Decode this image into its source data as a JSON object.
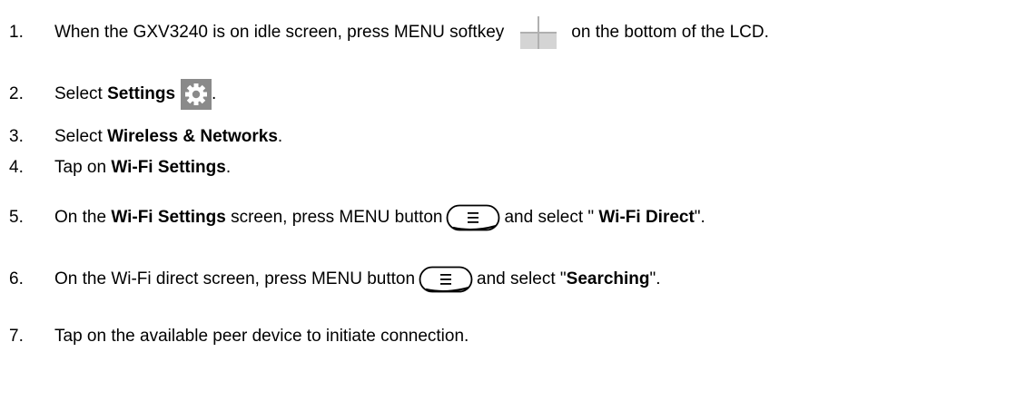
{
  "steps": [
    {
      "num": "1.",
      "a": "When the GXV3240 is on idle screen, press MENU softkey",
      "icon": "menu-softkey-icon",
      "b": "on the bottom of the LCD."
    },
    {
      "num": "2.",
      "a": "Select ",
      "bold": "Settings",
      "icon": "settings-gear-icon",
      "b": "."
    },
    {
      "num": "3.",
      "a": "Select ",
      "bold": "Wireless & Networks",
      "b": "."
    },
    {
      "num": "4.",
      "a": "Tap on ",
      "bold": "Wi-Fi Settings",
      "b": "."
    },
    {
      "num": "5.",
      "a": "On the ",
      "bold": "Wi-Fi Settings",
      "a2": " screen, press MENU button",
      "icon": "menu-button-icon",
      "b": "and select \" ",
      "bold2": "Wi-Fi Direct",
      "c": "\"."
    },
    {
      "num": "6.",
      "a": "On the Wi-Fi direct screen, press MENU button",
      "icon": "menu-button-icon",
      "b": "and select \"",
      "bold": "Searching",
      "c": "\"."
    },
    {
      "num": "7.",
      "a": "Tap on the available peer device to initiate connection."
    }
  ]
}
